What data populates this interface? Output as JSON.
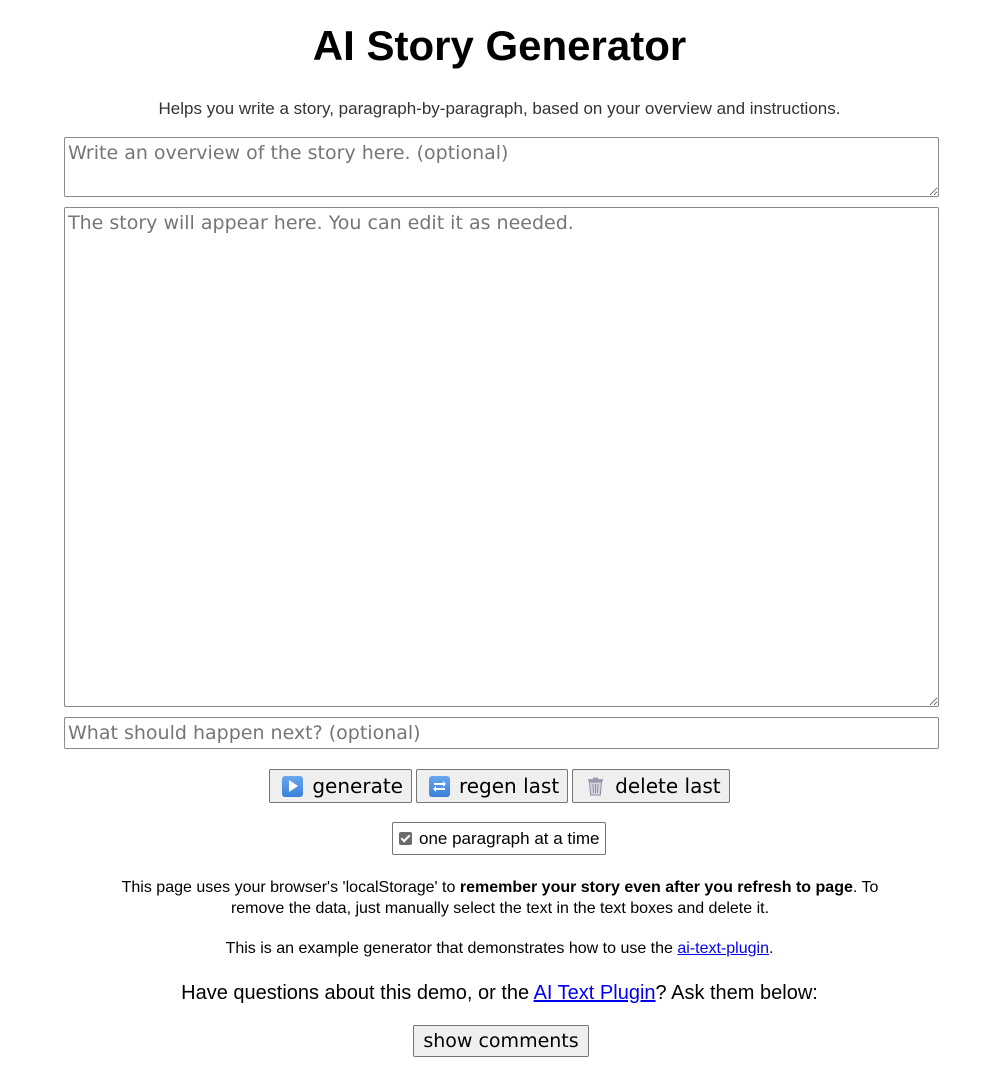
{
  "header": {
    "title": "AI Story Generator",
    "subtitle": "Helps you write a story, paragraph-by-paragraph, based on your overview and instructions."
  },
  "inputs": {
    "overview_placeholder": "Write an overview of the story here. (optional)",
    "overview_value": "",
    "story_placeholder": "The story will appear here. You can edit it as needed.",
    "story_value": "",
    "next_placeholder": "What should happen next? (optional)",
    "next_value": ""
  },
  "buttons": {
    "generate": {
      "label": "generate",
      "icon": "play-icon"
    },
    "regen_last": {
      "label": "regen last",
      "icon": "regen-icon"
    },
    "delete_last": {
      "label": "delete last",
      "icon": "trash-icon"
    },
    "show_comments": "show comments"
  },
  "options": {
    "one_paragraph_label": "one paragraph at a time",
    "one_paragraph_checked": true
  },
  "info": {
    "storage_prefix": "This page uses your browser's 'localStorage' to ",
    "storage_bold": "remember your story even after you refresh to page",
    "storage_suffix": ". To remove the data, just manually select the text in the text boxes and delete it.",
    "example_prefix": "This is an example generator that demonstrates how to use the ",
    "example_link": "ai-text-plugin",
    "example_suffix": ".",
    "questions_prefix": "Have questions about this demo, or the ",
    "questions_link": "AI Text Plugin",
    "questions_suffix": "? Ask them below:"
  },
  "colors": {
    "link": "#0000ee",
    "icon_blue": "#3a7fd8",
    "button_bg": "#efefef"
  }
}
